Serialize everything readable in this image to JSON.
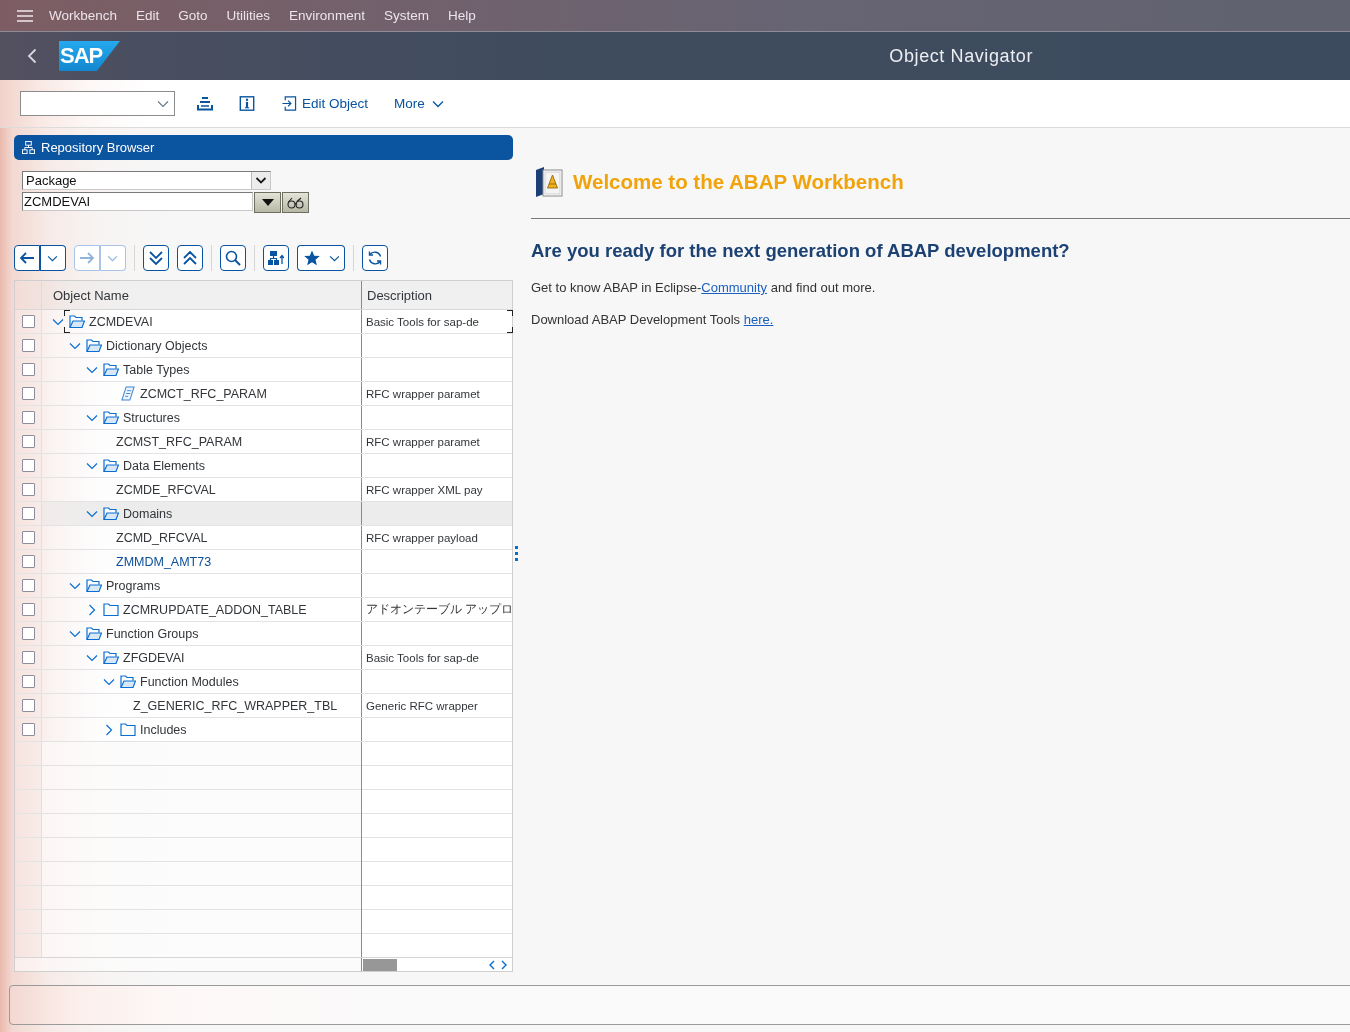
{
  "menu_bar": {
    "items": [
      "Workbench",
      "Edit",
      "Goto",
      "Utilities",
      "Environment",
      "System",
      "Help"
    ]
  },
  "title_bar": {
    "logo": "SAP",
    "title": "Object Navigator"
  },
  "toolbar": {
    "buttons": [
      {
        "kind": "object_list"
      },
      {
        "kind": "info"
      },
      {
        "kind": "edit_object",
        "label": "Edit Object"
      },
      {
        "kind": "more",
        "label": "More"
      }
    ]
  },
  "repository_browser": {
    "title": "Repository Browser",
    "object_type": {
      "value": "Package"
    },
    "object_name": {
      "value": "ZCMDEVAI"
    },
    "toolbar_groups": [
      {
        "buttons": [
          {
            "kind": "back",
            "disabled": false
          },
          {
            "kind": "forward",
            "disabled": true
          }
        ]
      },
      {
        "buttons": [
          {
            "kind": "expand_all",
            "disabled": false
          },
          {
            "kind": "collapse_all",
            "disabled": false
          }
        ]
      },
      {
        "buttons": [
          {
            "kind": "find",
            "disabled": false
          }
        ]
      },
      {
        "buttons": [
          {
            "kind": "hierarchy_up",
            "disabled": false
          },
          {
            "kind": "favorites",
            "disabled": false
          }
        ]
      },
      {
        "buttons": [
          {
            "kind": "refresh",
            "disabled": false
          }
        ]
      }
    ],
    "tree": {
      "columns": [
        "Object Name",
        "Description"
      ],
      "rows": [
        {
          "kind": "folder",
          "name": "ZCMDEVAI",
          "description": "Basic Tools for sap-de",
          "expanded": true,
          "selected": false,
          "focused": true,
          "highlighted": false,
          "checked": false,
          "children": [
            {
              "kind": "folder",
              "name": "Dictionary Objects",
              "expanded": true,
              "selected": false,
              "focused": false,
              "highlighted": false,
              "checked": false,
              "children": [
                {
                  "kind": "folder",
                  "name": "Table Types",
                  "expanded": true,
                  "selected": false,
                  "focused": false,
                  "highlighted": false,
                  "checked": false,
                  "children": [
                    {
                      "kind": "table_type",
                      "name": "ZCMCT_RFC_PARAM",
                      "description": "RFC wrapper paramet",
                      "selected": false,
                      "focused": false,
                      "highlighted": false,
                      "checked": false
                    }
                  ]
                },
                {
                  "kind": "folder",
                  "name": "Structures",
                  "expanded": true,
                  "selected": false,
                  "focused": false,
                  "highlighted": false,
                  "checked": false,
                  "children": [
                    {
                      "kind": "object",
                      "name": "ZCMST_RFC_PARAM",
                      "description": "RFC wrapper paramet",
                      "selected": false,
                      "focused": false,
                      "highlighted": false,
                      "checked": false
                    }
                  ]
                },
                {
                  "kind": "folder",
                  "name": "Data Elements",
                  "expanded": true,
                  "selected": false,
                  "focused": false,
                  "highlighted": false,
                  "checked": false,
                  "children": [
                    {
                      "kind": "object",
                      "name": "ZCMDE_RFCVAL",
                      "description": "RFC wrapper XML pay",
                      "selected": false,
                      "focused": false,
                      "highlighted": false,
                      "checked": false
                    }
                  ]
                },
                {
                  "kind": "folder",
                  "name": "Domains",
                  "expanded": true,
                  "selected": true,
                  "focused": false,
                  "highlighted": false,
                  "checked": false,
                  "children": [
                    {
                      "kind": "object",
                      "name": "ZCMD_RFCVAL",
                      "description": "RFC wrapper payload",
                      "selected": false,
                      "focused": false,
                      "highlighted": false,
                      "checked": false
                    },
                    {
                      "kind": "object",
                      "name": "ZMMDM_AMT73",
                      "selected": false,
                      "focused": false,
                      "highlighted": true,
                      "checked": false
                    }
                  ]
                }
              ]
            },
            {
              "kind": "folder",
              "name": "Programs",
              "expanded": true,
              "selected": false,
              "focused": false,
              "highlighted": false,
              "checked": false,
              "children": [
                {
                  "kind": "folder",
                  "name": "ZCMRUPDATE_ADDON_TABLE",
                  "description": "アドオンテーブル アップロ",
                  "expanded": false,
                  "selected": false,
                  "focused": false,
                  "highlighted": false,
                  "checked": false
                }
              ]
            },
            {
              "kind": "folder",
              "name": "Function Groups",
              "expanded": true,
              "selected": false,
              "focused": false,
              "highlighted": false,
              "checked": false,
              "children": [
                {
                  "kind": "folder",
                  "name": "ZFGDEVAI",
                  "description": "Basic Tools for sap-de",
                  "expanded": true,
                  "selected": false,
                  "focused": false,
                  "highlighted": false,
                  "checked": false,
                  "children": [
                    {
                      "kind": "folder",
                      "name": "Function Modules",
                      "expanded": true,
                      "selected": false,
                      "focused": false,
                      "highlighted": false,
                      "checked": false,
                      "children": [
                        {
                          "kind": "object",
                          "name": "Z_GENERIC_RFC_WRAPPER_TBL",
                          "description": "Generic RFC wrapper",
                          "selected": false,
                          "focused": false,
                          "highlighted": false,
                          "checked": false
                        }
                      ]
                    },
                    {
                      "kind": "folder",
                      "name": "Includes",
                      "expanded": false,
                      "selected": false,
                      "focused": false,
                      "highlighted": false,
                      "checked": false
                    }
                  ]
                }
              ]
            }
          ]
        }
      ]
    }
  },
  "welcome": {
    "title": "Welcome to the ABAP Workbench",
    "heading": "Are you ready for the next generation of ABAP development?",
    "paragraphs": [
      {
        "before": "Get to know ABAP in Eclipse-",
        "link": "Community",
        "after": " and find out more."
      },
      {
        "before": "Download ABAP Development Tools ",
        "link": "here."
      }
    ]
  }
}
